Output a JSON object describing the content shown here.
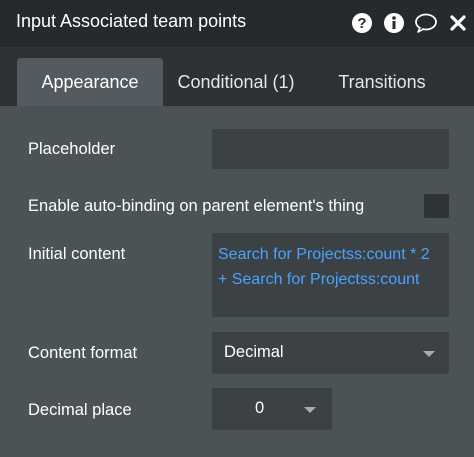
{
  "window": {
    "title": "Input Associated team points",
    "icons": [
      "help-icon",
      "info-icon",
      "comment-icon",
      "close-icon"
    ]
  },
  "tabs": [
    {
      "label": "Appearance",
      "active": true
    },
    {
      "label": "Conditional (1)",
      "active": false
    },
    {
      "label": "Transitions",
      "active": false
    }
  ],
  "form": {
    "placeholder_label": "Placeholder",
    "placeholder_value": "",
    "autobinding_label": "Enable auto-binding on parent element's thing",
    "autobinding_checked": false,
    "initial_content_label": "Initial content",
    "initial_content_value": "Search for Projectss:count * 2 + Search for Projectss:count",
    "content_format_label": "Content format",
    "content_format_value": "Decimal",
    "decimal_place_label": "Decimal place",
    "decimal_place_value": "0"
  },
  "colors": {
    "titlebar": "#252a2d",
    "background": "#2d3134",
    "panel": "#4c5357",
    "active_tab": "#545b60",
    "field": "#3b4145",
    "dynamic_text": "#4aa3ff"
  }
}
